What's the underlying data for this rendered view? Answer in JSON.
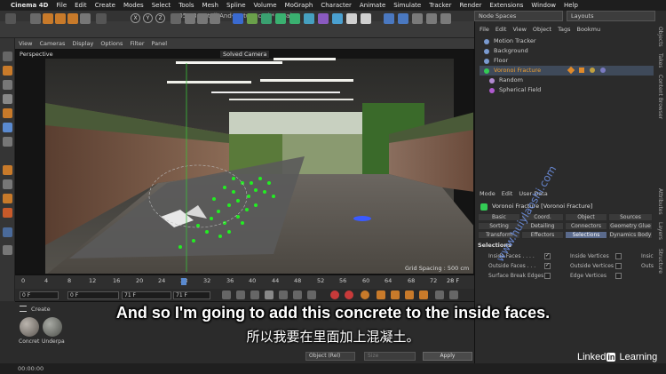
{
  "menubar": {
    "app_name": "Cinema 4D",
    "items": [
      "File",
      "Edit",
      "Create",
      "Modes",
      "Select",
      "Tools",
      "Mesh",
      "Spline",
      "Volume",
      "MoGraph",
      "Character",
      "Animate",
      "Simulate",
      "Tracker",
      "Render",
      "Extensions",
      "Window",
      "Help"
    ]
  },
  "document": {
    "title": "05-03-Detail-And-Texture.c4d * - Main"
  },
  "toolbar": {
    "axis_x": "X",
    "axis_y": "Y",
    "axis_z": "Z"
  },
  "viewport": {
    "menu": [
      "View",
      "Cameras",
      "Display",
      "Options",
      "Filter",
      "Panel"
    ],
    "label": "Perspective",
    "camera": "Solved Camera",
    "grid_spacing": "Grid Spacing : 500 cm"
  },
  "timeline": {
    "ticks": [
      "0",
      "4",
      "8",
      "12",
      "16",
      "20",
      "24",
      "28",
      "32",
      "36",
      "40",
      "44",
      "48",
      "52",
      "56",
      "60",
      "64",
      "68",
      "72"
    ],
    "end_frame_right": "28 F",
    "current_frame": "0 F",
    "min_frame": "0 F",
    "max_frame": "71 F",
    "max_frame2": "71 F"
  },
  "material_manager": {
    "menu_label": "Create",
    "materials": [
      {
        "label": "Concret",
        "color": "#8a8580"
      },
      {
        "label": "Underpa",
        "color": "#7d7f7a"
      }
    ]
  },
  "coord_panel": {
    "mode": "Object (Rel)",
    "size": "Size",
    "apply": "Apply"
  },
  "status": {
    "time": "00:00:00"
  },
  "right": {
    "node_spaces": "Node Spaces",
    "layouts": "Layouts",
    "object_menu": [
      "File",
      "Edit",
      "View",
      "Object",
      "Tags",
      "Bookmu"
    ],
    "objects": [
      {
        "name": "Motion Tracker",
        "color": "#7a9ad0"
      },
      {
        "name": "Background",
        "color": "#7a9ad0"
      },
      {
        "name": "Floor",
        "color": "#7a9ad0"
      },
      {
        "name": "Voronoi Fracture",
        "color": "#33cc55"
      },
      {
        "name": "Random",
        "color": "#b28ad0"
      },
      {
        "name": "Spherical Field",
        "color": "#b05ad0"
      }
    ],
    "side_tabs": [
      "Objects",
      "Takes",
      "Content Browser"
    ],
    "attr_side_tabs": [
      "Attributes",
      "Layers",
      "Structure"
    ],
    "attr_menu": [
      "Mode",
      "Edit",
      "User Data"
    ],
    "attr_title": "Voronoi Fracture [Voronoi Fracture]",
    "attr_tabs": [
      "Basic",
      "Coord.",
      "Object",
      "Sources",
      "Sorting",
      "Detailing",
      "Connectors",
      "Geometry Glue",
      "Transform",
      "Effectors",
      "Selections",
      "Dynamics Body"
    ],
    "selections_header": "Selections",
    "sel_col1": [
      "Inside Faces . . . .",
      "Outside Faces . . .",
      "Surface Break Edges"
    ],
    "sel_col2": [
      "Inside Vertices",
      "Outside Vertices",
      "Edge Vertices"
    ],
    "sel_col3": [
      "Insic",
      "Outs"
    ]
  },
  "subtitles": {
    "en": "And so I'm going to add this concrete to the inside faces.",
    "zh": "所以我要在里面加上混凝土。"
  },
  "watermark": "www.huiylaoshi.com",
  "branding": {
    "linked": "Linked",
    "in": "in",
    "learning": "Learning"
  }
}
